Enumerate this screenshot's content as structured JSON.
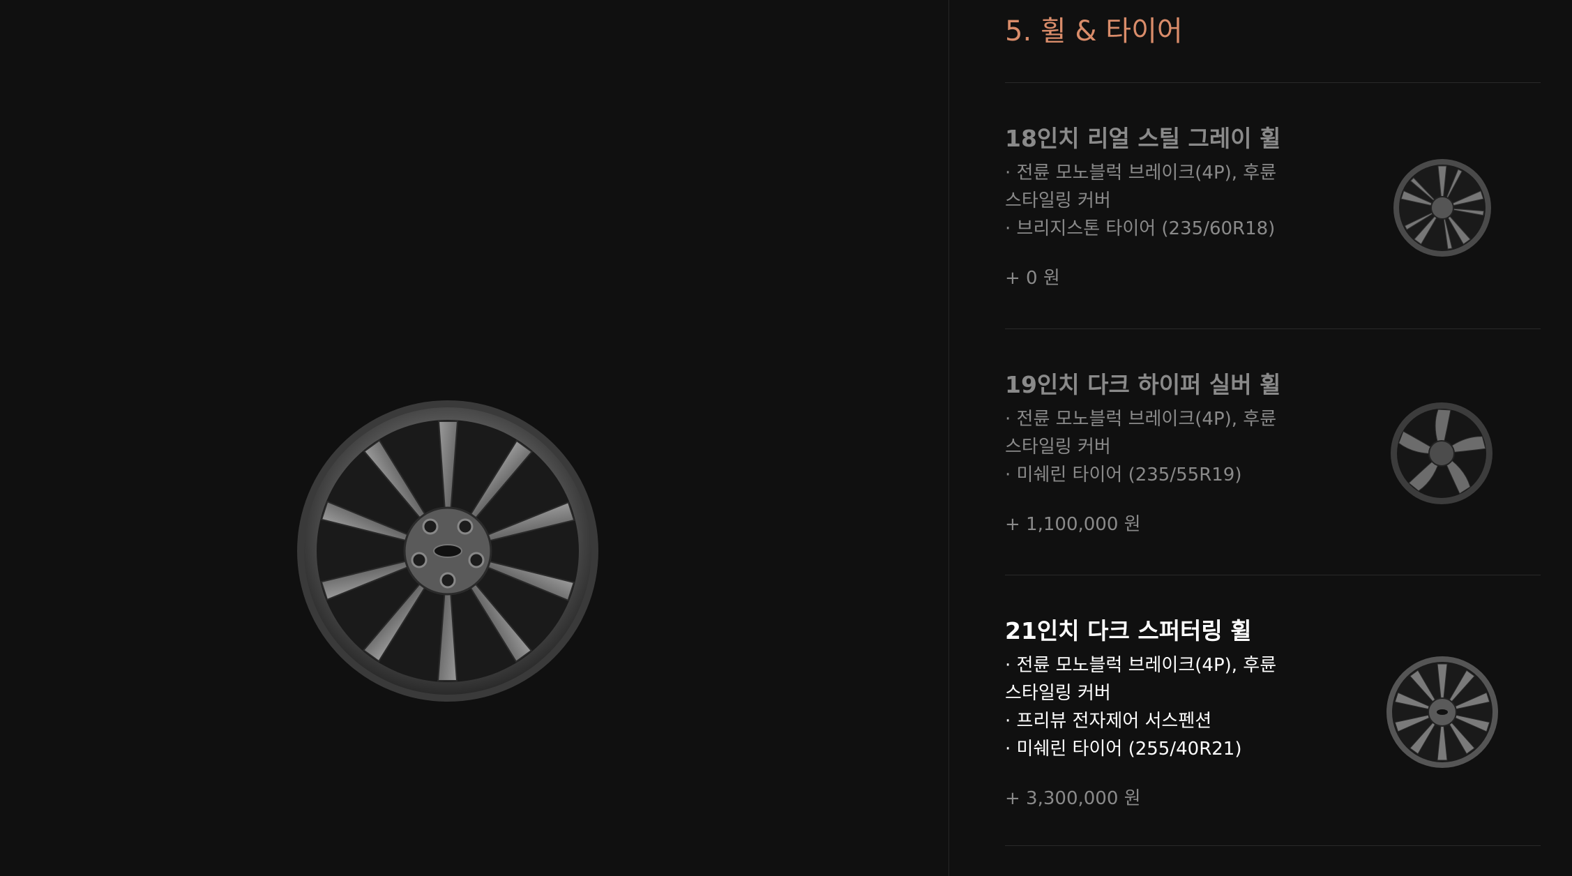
{
  "section": {
    "title": "5. 휠 & 타이어"
  },
  "options": [
    {
      "name": "18인치 리얼 스틸 그레이 휠",
      "desc": [
        "· 전륜 모노블럭 브레이크(4P), 후륜",
        "스타일링 커버",
        "· 브리지스톤 타이어 (235/60R18)"
      ],
      "price": "+ 0 원",
      "thumb_icon": "wheel-18-thumbnail-icon",
      "selected": false
    },
    {
      "name": "19인치 다크 하이퍼 실버 휠",
      "desc": [
        "· 전륜 모노블럭 브레이크(4P), 후륜",
        "스타일링 커버",
        "· 미쉐린 타이어 (235/55R19)"
      ],
      "price": "+ 1,100,000 원",
      "thumb_icon": "wheel-19-thumbnail-icon",
      "selected": false
    },
    {
      "name": "21인치 다크 스퍼터링 휠",
      "desc": [
        "· 전륜 모노블럭 브레이크(4P), 후륜",
        "스타일링 커버",
        "· 프리뷰 전자제어 서스펜션",
        "· 미쉐린 타이어 (255/40R21)"
      ],
      "price": "+ 3,300,000 원",
      "thumb_icon": "wheel-21-thumbnail-icon",
      "selected": true
    }
  ],
  "colors": {
    "accent": "#d98c6a",
    "background": "#101010",
    "muted_text": "#8a8a8a",
    "selected_text": "#ffffff"
  }
}
